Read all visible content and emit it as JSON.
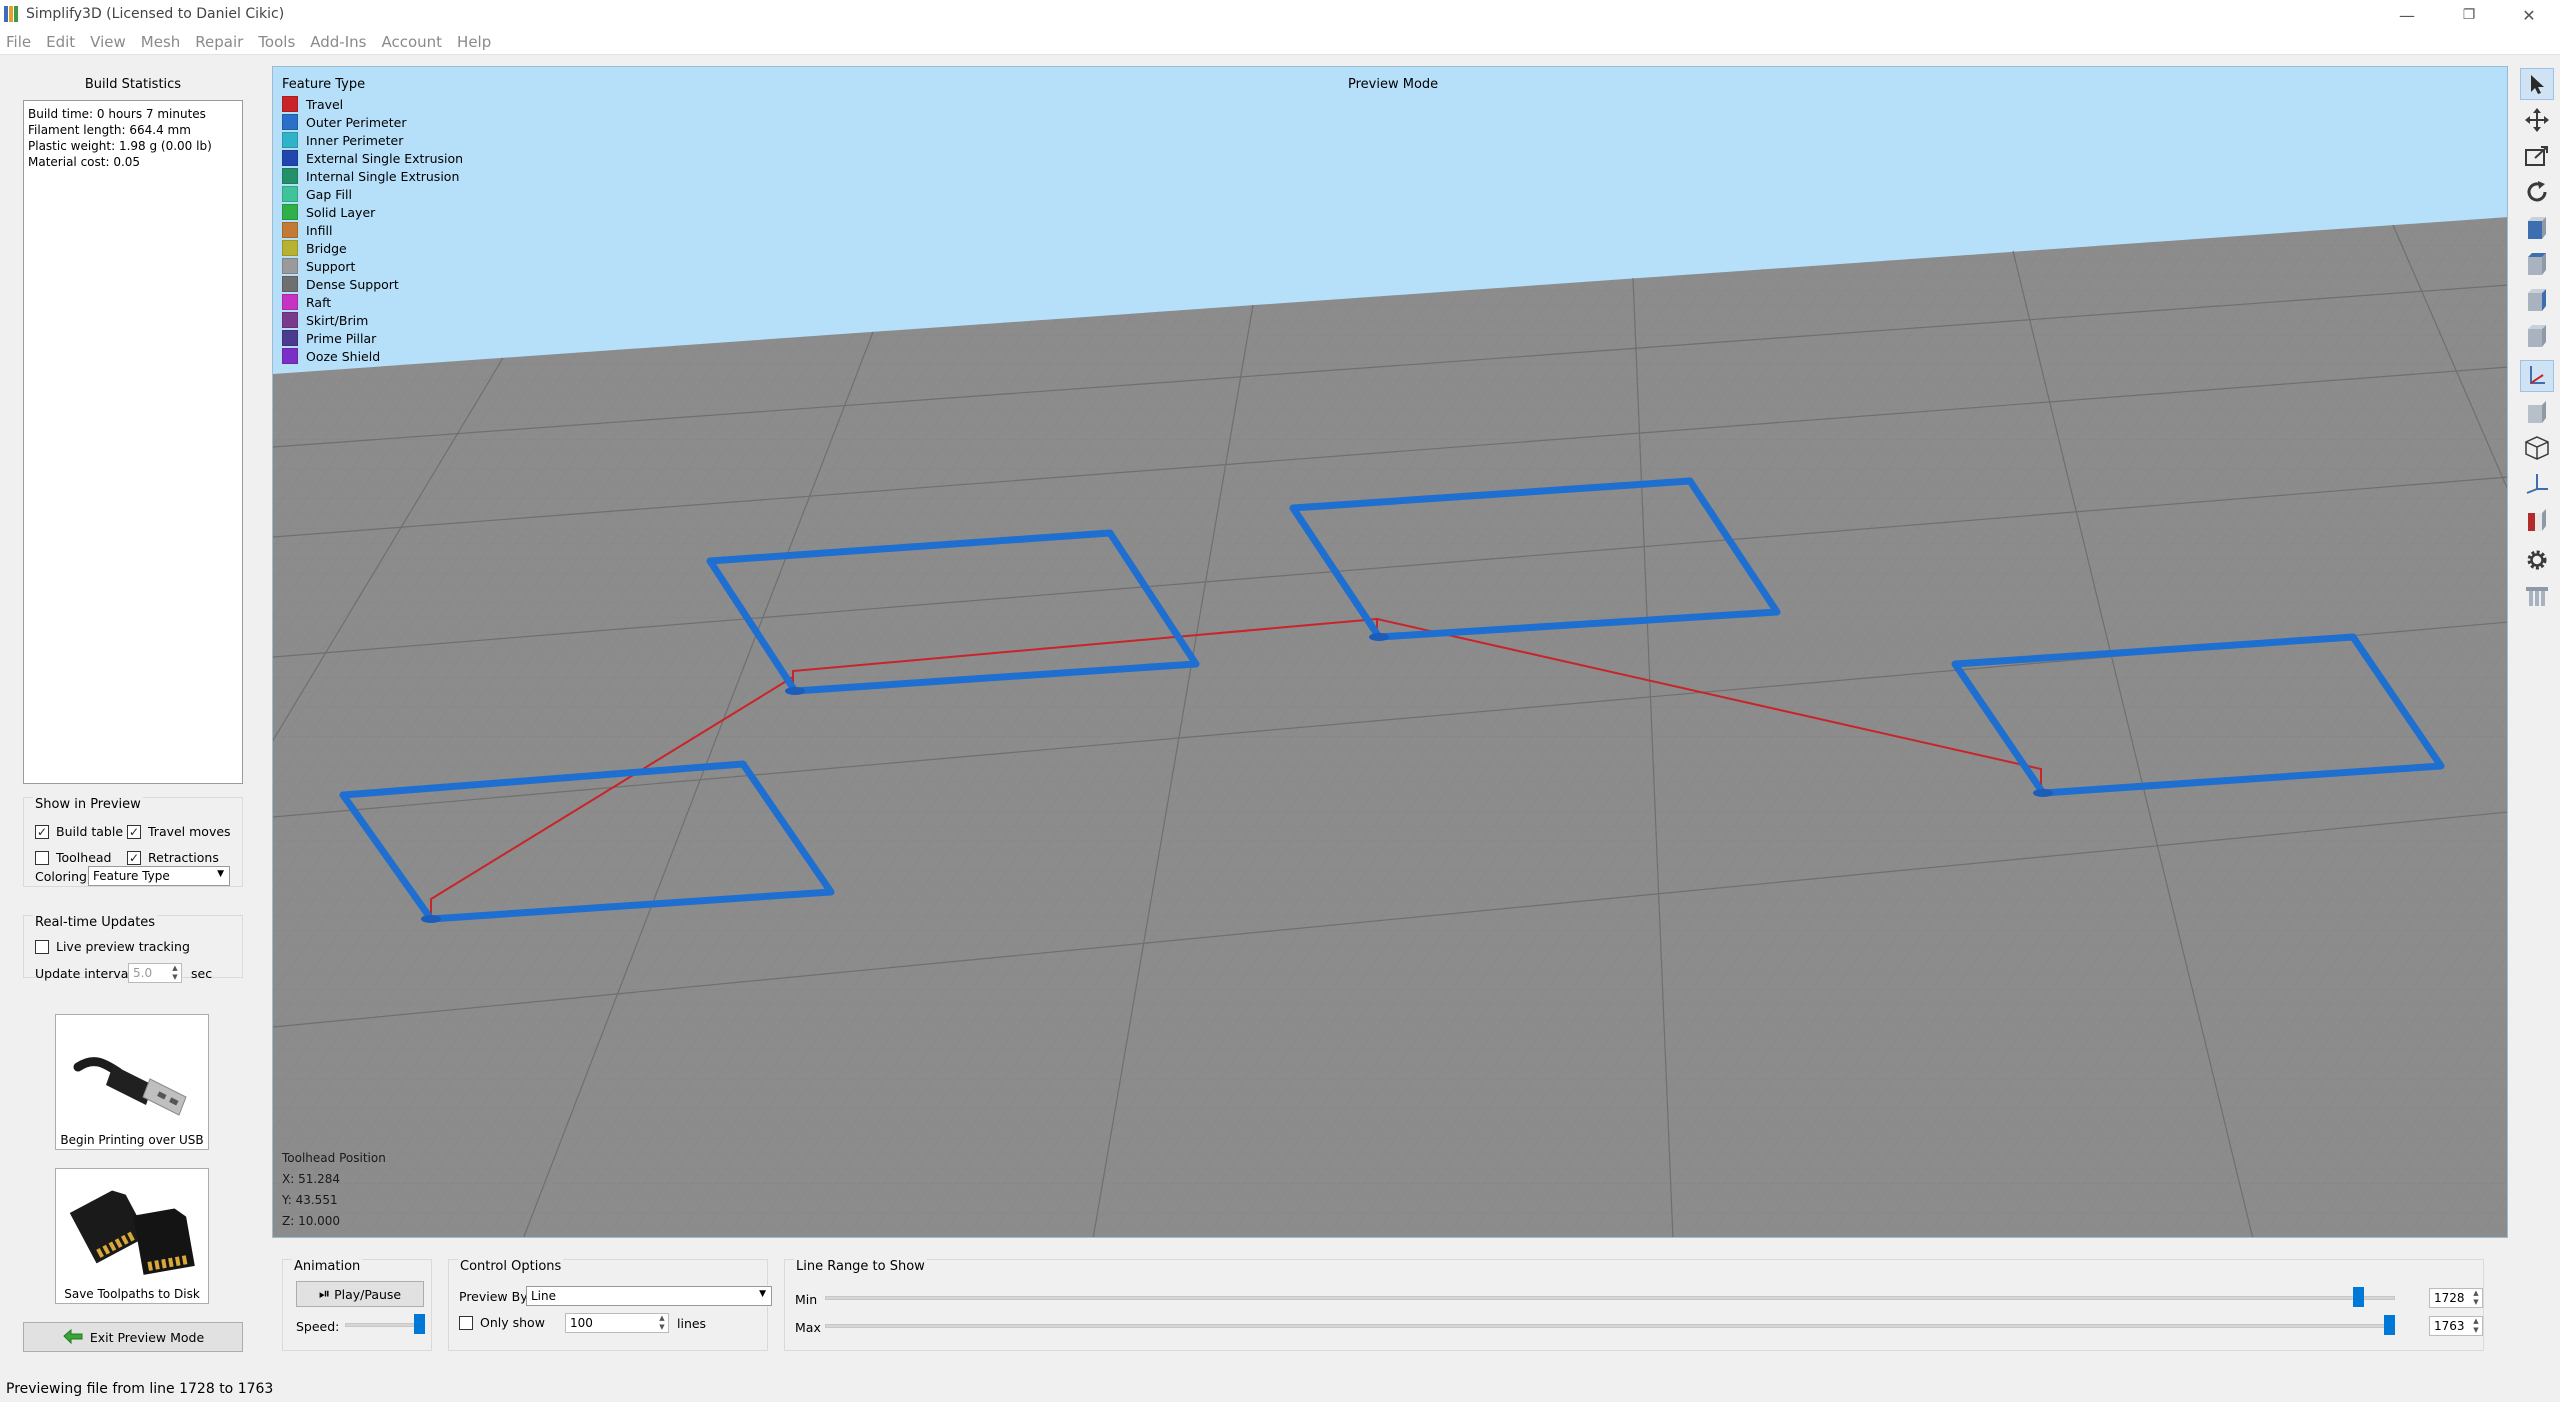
{
  "window": {
    "title": "Simplify3D (Licensed to Daniel Cikic)",
    "controls": {
      "minimize": "—",
      "maximize": "❐",
      "close": "✕"
    }
  },
  "menu": {
    "items": [
      "File",
      "Edit",
      "View",
      "Mesh",
      "Repair",
      "Tools",
      "Add-Ins",
      "Account",
      "Help"
    ]
  },
  "build_statistics": {
    "title": "Build Statistics",
    "lines": [
      "Build time: 0 hours 7 minutes",
      "Filament length: 664.4 mm",
      "Plastic weight: 1.98 g (0.00 lb)",
      "Material cost: 0.05"
    ]
  },
  "show_in_preview": {
    "title": "Show in Preview",
    "build_table": {
      "label": "Build table",
      "checked": true
    },
    "travel_moves": {
      "label": "Travel moves",
      "checked": true
    },
    "toolhead": {
      "label": "Toolhead",
      "checked": false
    },
    "retractions": {
      "label": "Retractions",
      "checked": true
    },
    "coloring_label": "Coloring",
    "coloring_value": "Feature Type"
  },
  "realtime_updates": {
    "title": "Real-time Updates",
    "live_preview": {
      "label": "Live preview tracking",
      "checked": false
    },
    "update_interval_label": "Update interval",
    "update_interval_value": "5.0",
    "update_interval_unit": "sec"
  },
  "buttons": {
    "usb_print": "Begin Printing over USB",
    "save_disk": "Save Toolpaths to Disk",
    "exit_preview": "Exit Preview Mode"
  },
  "viewport": {
    "mode_label": "Preview Mode",
    "legend_title": "Feature Type",
    "legend": [
      {
        "label": "Travel",
        "color": "#c8242a"
      },
      {
        "label": "Outer Perimeter",
        "color": "#2a6fc9"
      },
      {
        "label": "Inner Perimeter",
        "color": "#2fb3c8"
      },
      {
        "label": "External Single Extrusion",
        "color": "#2246b0"
      },
      {
        "label": "Internal Single Extrusion",
        "color": "#23906a"
      },
      {
        "label": "Gap Fill",
        "color": "#3fc49a"
      },
      {
        "label": "Solid Layer",
        "color": "#2fb04a"
      },
      {
        "label": "Infill",
        "color": "#c27a34"
      },
      {
        "label": "Bridge",
        "color": "#b8b232"
      },
      {
        "label": "Support",
        "color": "#9a9a9a"
      },
      {
        "label": "Dense Support",
        "color": "#6f6f6f"
      },
      {
        "label": "Raft",
        "color": "#c632c4"
      },
      {
        "label": "Skirt/Brim",
        "color": "#7a3a8c"
      },
      {
        "label": "Prime Pillar",
        "color": "#4b3a8f"
      },
      {
        "label": "Ooze Shield",
        "color": "#7a2fc7"
      }
    ],
    "toolhead_position": {
      "title": "Toolhead Position",
      "x": "X: 51.284",
      "y": "Y: 43.551",
      "z": "Z: 10.000"
    },
    "colors": {
      "sky": "#b6e0fa",
      "bed": "#8c8c8c",
      "grid": "#7a7a7a",
      "path": "#1f6fd0",
      "travel": "#c8242a"
    }
  },
  "animation": {
    "title": "Animation",
    "play_pause": "Play/Pause",
    "speed_label": "Speed:",
    "speed_fraction": 1.0
  },
  "control_options": {
    "title": "Control Options",
    "preview_by_label": "Preview By",
    "preview_by_value": "Line",
    "only_show": {
      "label": "Only show",
      "checked": false
    },
    "only_show_value": "100",
    "only_show_unit": "lines"
  },
  "line_range": {
    "title": "Line Range to Show",
    "min_label": "Min",
    "min_value": "1728",
    "max_label": "Max",
    "max_value": "1763",
    "min_fraction": 0.98,
    "max_fraction": 1.0
  },
  "status": {
    "text": "Previewing file from line 1728 to 1763"
  }
}
